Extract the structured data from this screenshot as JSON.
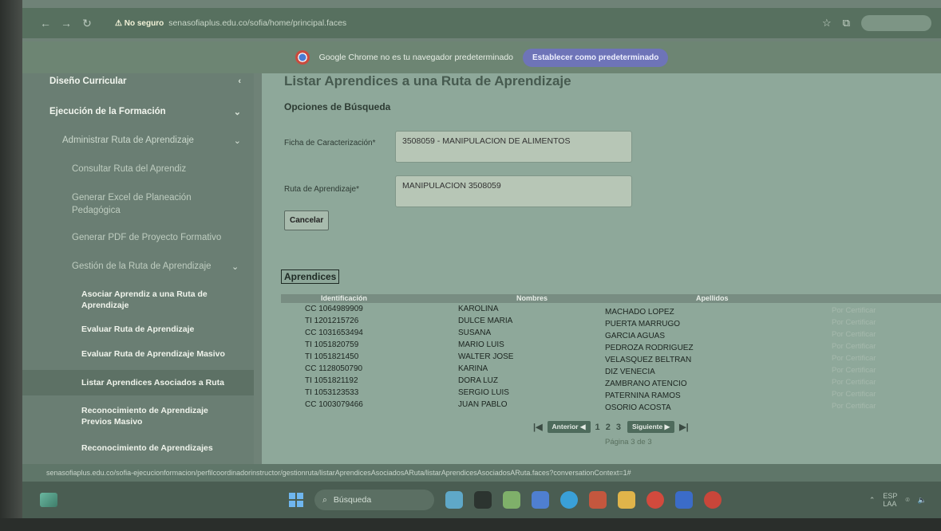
{
  "browser": {
    "security_warning": "⚠ No seguro",
    "url": "senasofiaplus.edu.co/sofia/home/principal.faces"
  },
  "banner": {
    "text": "Google Chrome no es tu navegador predeterminado",
    "button": "Establecer como predeterminado"
  },
  "sidebar": {
    "items": [
      {
        "label": "Diseño Curricular"
      },
      {
        "label": "Ejecución de la Formación"
      },
      {
        "label": "Administrar Ruta de Aprendizaje"
      },
      {
        "label": "Consultar Ruta del Aprendiz"
      },
      {
        "label": "Generar Excel de Planeación Pedagógica"
      },
      {
        "label": "Generar PDF de Proyecto Formativo"
      },
      {
        "label": "Gestión de la Ruta de Aprendizaje"
      },
      {
        "label": "Asociar Aprendiz a una Ruta de Aprendizaje"
      },
      {
        "label": "Evaluar Ruta de Aprendizaje"
      },
      {
        "label": "Evaluar Ruta de Aprendizaje Masivo"
      },
      {
        "label": "Listar Aprendices Asociados a Ruta"
      },
      {
        "label": "Reconocimiento de Aprendizaje Previos Masivo"
      },
      {
        "label": "Reconocimiento de Aprendizajes"
      }
    ]
  },
  "main": {
    "page_heading": "Listar Aprendices a una Ruta de Aprendizaje",
    "section_title": "Opciones de Búsqueda",
    "ficha_label": "Ficha de Caracterización*",
    "ficha_value": "3508059 - MANIPULACION DE ALIMENTOS",
    "ruta_label": "Ruta de Aprendizaje*",
    "ruta_value": "MANIPULACION 3508059",
    "cancel_button": "Cancelar",
    "aprendices_title": "Aprendices"
  },
  "table": {
    "headers": [
      "Identificación",
      "Nombres",
      "Apellidos"
    ],
    "rows": [
      {
        "id": "CC 1064989909",
        "nombres": "KAROLINA",
        "apellidos": "MACHADO LOPEZ",
        "estado": "Por Certificar"
      },
      {
        "id": "TI 1201215726",
        "nombres": "DULCE MARIA",
        "apellidos": "PUERTA MARRUGO",
        "estado": "Por Certificar"
      },
      {
        "id": "CC 1031653494",
        "nombres": "SUSANA",
        "apellidos": "GARCIA AGUAS",
        "estado": "Por Certificar"
      },
      {
        "id": "TI 1051820759",
        "nombres": "MARIO LUIS",
        "apellidos": "PEDROZA RODRIGUEZ",
        "estado": "Por Certificar"
      },
      {
        "id": "TI 1051821450",
        "nombres": "WALTER JOSE",
        "apellidos": "VELASQUEZ BELTRAN",
        "estado": "Por Certificar"
      },
      {
        "id": "CC 1128050790",
        "nombres": "KARINA",
        "apellidos": "DIZ VENECIA",
        "estado": "Por Certificar"
      },
      {
        "id": "TI 1051821192",
        "nombres": "DORA LUZ",
        "apellidos": "ZAMBRANO ATENCIO",
        "estado": "Por Certificar"
      },
      {
        "id": "TI 1053123533",
        "nombres": "SERGIO LUIS",
        "apellidos": "PATERNINA RAMOS",
        "estado": "Por Certificar"
      },
      {
        "id": "CC 1003079466",
        "nombres": "JUAN PABLO",
        "apellidos": "OSORIO ACOSTA",
        "estado": "Por Certificar"
      }
    ]
  },
  "pagination": {
    "first": "|◀",
    "prev": "Anterior ◀",
    "pages": "1 2 3",
    "next": "Siguiente ▶",
    "last": "▶|",
    "status": "Página 3 de 3"
  },
  "statusbar": {
    "text": "senasofiaplus.edu.co/sofia-ejecucionformacion/perfilcoordinadorinstructor/gestionruta/listarAprendicesAsociadosARuta/listarAprendicesAsociadosARuta.faces?conversationContext=1#"
  },
  "taskbar": {
    "search_placeholder": "Búsqueda",
    "lang_top": "ESP",
    "lang_bottom": "LAA"
  },
  "colors": {
    "accent_button": "#6e74b8",
    "table_header": "#788d82",
    "pager_button": "#4e6b5c"
  }
}
